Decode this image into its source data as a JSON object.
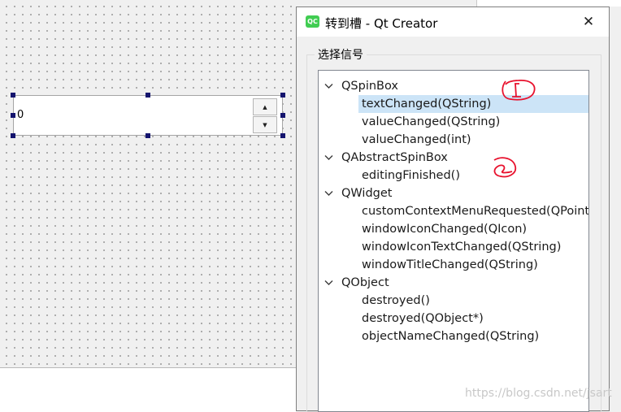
{
  "designer": {
    "spinbox": {
      "value": "0",
      "up_glyph": "▲",
      "down_glyph": "▼"
    }
  },
  "dialog": {
    "logo_text": "QC",
    "title": "转到槽 - Qt Creator",
    "close_glyph": "✕",
    "group_label": "选择信号",
    "tree": [
      {
        "label": "QSpinBox",
        "level": 0,
        "expanded": true
      },
      {
        "label": "textChanged(QString)",
        "level": 1,
        "selected": true
      },
      {
        "label": "valueChanged(QString)",
        "level": 1
      },
      {
        "label": "valueChanged(int)",
        "level": 1
      },
      {
        "label": "QAbstractSpinBox",
        "level": 0,
        "expanded": true
      },
      {
        "label": "editingFinished()",
        "level": 1
      },
      {
        "label": "QWidget",
        "level": 0,
        "expanded": true
      },
      {
        "label": "customContextMenuRequested(QPoint)",
        "level": 1
      },
      {
        "label": "windowIconChanged(QIcon)",
        "level": 1
      },
      {
        "label": "windowIconTextChanged(QString)",
        "level": 1
      },
      {
        "label": "windowTitleChanged(QString)",
        "level": 1
      },
      {
        "label": "QObject",
        "level": 0,
        "expanded": true
      },
      {
        "label": "destroyed()",
        "level": 1
      },
      {
        "label": "destroyed(QObject*)",
        "level": 1
      },
      {
        "label": "objectNameChanged(QString)",
        "level": 1
      }
    ]
  },
  "annotations": {
    "mark1": "1",
    "mark2": "2",
    "color": "#e8112d"
  },
  "colors": {
    "selection": "#cce4f7",
    "handle": "#14146e",
    "qt_green": "#41cd52"
  },
  "watermark": "https://blog.csdn.net/jsart"
}
